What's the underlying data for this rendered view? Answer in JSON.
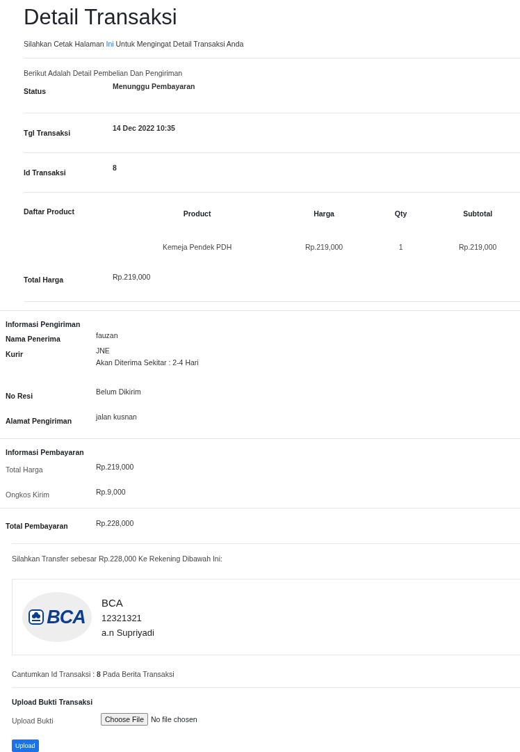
{
  "title": "Detail Transaksi",
  "subtitle": {
    "before": "Silahkan Cetak Halaman",
    "link": "Ini",
    "after": "Untuk Mengingat Detail Transaksi Anda"
  },
  "intro": "Berikut Adalah Detail Pembelian Dan Pengiriman",
  "details": [
    {
      "label": "Status",
      "value": "Menunggu Pembayaran"
    },
    {
      "label": "Tgl Transaksi",
      "value": "14 Dec 2022 10:35"
    },
    {
      "label": "Id Transaksi",
      "value": "8"
    }
  ],
  "products": {
    "label": "Daftar Product",
    "columns": [
      "Product",
      "Harga",
      "Qty",
      "Subtotal"
    ],
    "rows": [
      [
        "Kemeja Pendek PDH",
        "Rp.219,000",
        "1",
        "Rp.219,000"
      ]
    ]
  },
  "total": {
    "label": "Total Harga",
    "value": "Rp.219,000"
  },
  "shipping": {
    "title": "Informasi Pengiriman",
    "rows": [
      {
        "label": "Nama Penerima",
        "lines": [
          "fauzan"
        ]
      },
      {
        "label": "Kurir",
        "lines": [
          "JNE",
          "Akan Diterima Sekitar : 2-4 Hari"
        ]
      },
      {
        "label": "No Resi",
        "lines": [
          "Belum Dikirim"
        ]
      },
      {
        "label": "Alamat Pengiriman",
        "lines": [
          "jalan kusnan"
        ]
      }
    ]
  },
  "payment": {
    "title": "Informasi Pembayaran",
    "rows": [
      {
        "label": "Total Harga",
        "value": "Rp.219,000"
      },
      {
        "label": "Ongkos Kirim",
        "value": "Rp.9,000"
      }
    ],
    "total": {
      "label": "Total Pembayaran",
      "value": "Rp.228,000"
    }
  },
  "transfer_note": "Silahkan Transfer sebesar Rp.228,000 Ke Rekening Dibawah Ini:",
  "bank": {
    "logo_text": "BCA",
    "name": "BCA",
    "account": "12321321",
    "holder": "a.n Supriyadi"
  },
  "reference_note": "Cantumkan Id Transaksi : **8** Pada Berita Transaksi",
  "upload": {
    "title": "Upload Bukti Transaksi",
    "label": "Upload Bukti",
    "choose": "Choose File",
    "file_status": "No file chosen",
    "submit": "Upload"
  }
}
